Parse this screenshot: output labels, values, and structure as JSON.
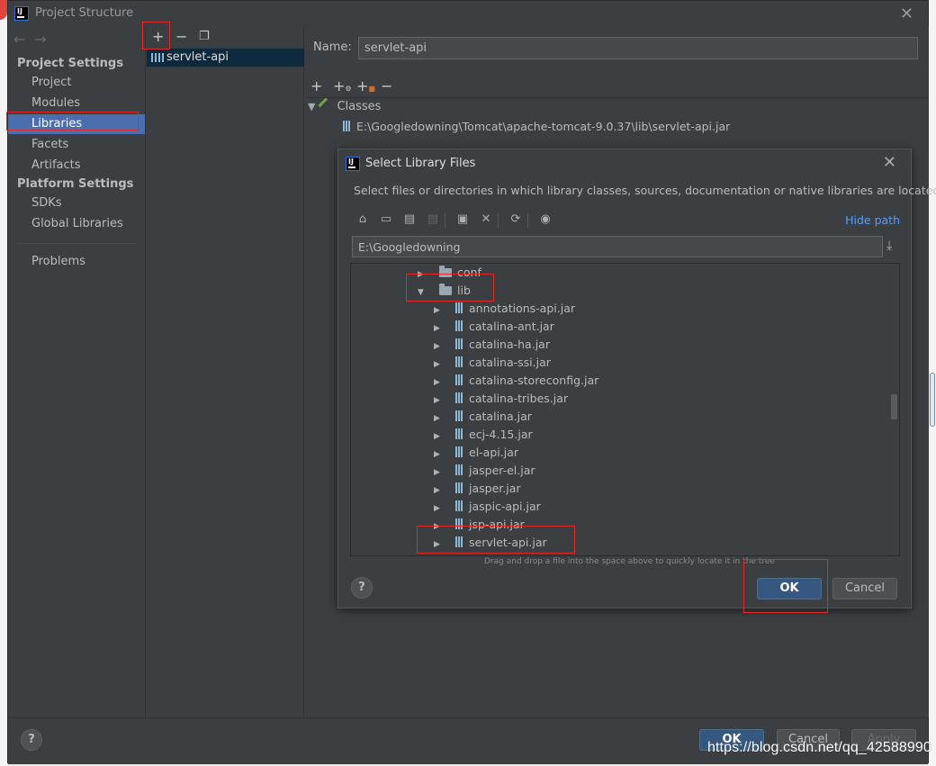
{
  "window": {
    "title": "Project Structure"
  },
  "nav": {
    "group_project_settings": "Project Settings",
    "group_platform_settings": "Platform Settings",
    "items": [
      {
        "label": "Project"
      },
      {
        "label": "Modules"
      },
      {
        "label": "Libraries",
        "selected": true
      },
      {
        "label": "Facets"
      },
      {
        "label": "Artifacts"
      },
      {
        "label": "SDKs"
      },
      {
        "label": "Global Libraries"
      },
      {
        "label": "Problems"
      }
    ]
  },
  "libraries": {
    "toolbar": {
      "add": "+",
      "remove": "−"
    },
    "items": [
      {
        "name": "servlet-api",
        "selected": true
      }
    ]
  },
  "library_detail": {
    "name_label": "Name:",
    "name_value": "servlet-api",
    "toolbar": {
      "add": "+",
      "remove": "−"
    },
    "classes_label": "Classes",
    "classes_path": "E:\\Googledowning\\Tomcat\\apache-tomcat-9.0.37\\lib\\servlet-api.jar"
  },
  "dialog": {
    "title": "Select Library Files",
    "description": "Select files or directories in which library classes, sources, documentation or native libraries are located",
    "hide_path": "Hide path",
    "path_value": "E:\\Googledowning",
    "tree": [
      {
        "label": "conf",
        "type": "folder",
        "expanded": false,
        "depth": 1
      },
      {
        "label": "lib",
        "type": "folder",
        "expanded": true,
        "depth": 1
      },
      {
        "label": "annotations-api.jar",
        "type": "jar",
        "depth": 2
      },
      {
        "label": "catalina-ant.jar",
        "type": "jar",
        "depth": 2
      },
      {
        "label": "catalina-ha.jar",
        "type": "jar",
        "depth": 2
      },
      {
        "label": "catalina-ssi.jar",
        "type": "jar",
        "depth": 2
      },
      {
        "label": "catalina-storeconfig.jar",
        "type": "jar",
        "depth": 2
      },
      {
        "label": "catalina-tribes.jar",
        "type": "jar",
        "depth": 2
      },
      {
        "label": "catalina.jar",
        "type": "jar",
        "depth": 2
      },
      {
        "label": "ecj-4.15.jar",
        "type": "jar",
        "depth": 2
      },
      {
        "label": "el-api.jar",
        "type": "jar",
        "depth": 2
      },
      {
        "label": "jasper-el.jar",
        "type": "jar",
        "depth": 2
      },
      {
        "label": "jasper.jar",
        "type": "jar",
        "depth": 2
      },
      {
        "label": "jaspic-api.jar",
        "type": "jar",
        "depth": 2
      },
      {
        "label": "jsp-api.jar",
        "type": "jar",
        "depth": 2
      },
      {
        "label": "servlet-api.jar",
        "type": "jar",
        "depth": 2
      }
    ],
    "hint": "Drag and drop a file into the space above to quickly locate it in the tree",
    "ok_label": "OK",
    "cancel_label": "Cancel",
    "help_label": "?"
  },
  "footer": {
    "help_label": "?",
    "ok_label": "OK",
    "cancel_label": "Cancel",
    "apply_label": "Apply"
  },
  "watermark": "https://blog.csdn.net/qq_42588990",
  "colors": {
    "background": "#3c3f41",
    "selection": "#4b6eaf",
    "primary_button": "#365880",
    "link": "#589df6",
    "annotation_red": "#e02a2a"
  }
}
